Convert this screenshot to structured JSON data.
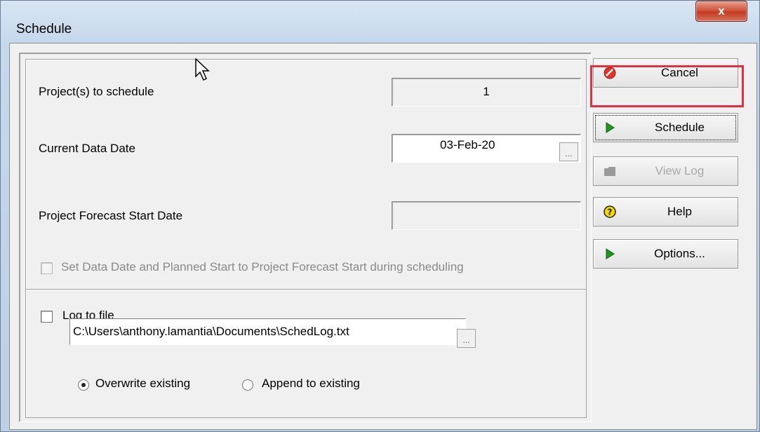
{
  "window": {
    "title": "Schedule",
    "close_glyph": "x"
  },
  "fields": {
    "projects_label": "Project(s) to schedule",
    "projects_value": "1",
    "data_date_label": "Current Data Date",
    "data_date_value": "03-Feb-20",
    "forecast_label": "Project Forecast Start Date",
    "forecast_value": "",
    "ellipsis": "..."
  },
  "options": {
    "set_data_date_label": "Set Data Date and Planned Start to Project Forecast Start during scheduling",
    "set_data_date_checked": false,
    "log_to_file_label": "Log to file",
    "log_to_file_checked": false,
    "log_path": "C:\\Users\\anthony.lamantia\\Documents\\SchedLog.txt",
    "overwrite_label": "Overwrite existing",
    "append_label": "Append to existing",
    "write_mode": "overwrite"
  },
  "buttons": {
    "cancel": {
      "label": "Cancel",
      "icon": "no-entry-icon",
      "color": "#e0332b"
    },
    "schedule": {
      "label": "Schedule",
      "icon": "play-triangle-icon",
      "color": "#1f9a1f"
    },
    "view_log": {
      "label": "View Log",
      "icon": "folder-icon"
    },
    "help": {
      "label": "Help",
      "icon": "help-icon",
      "color": "#f5d800"
    },
    "options": {
      "label": "Options...",
      "icon": "play-triangle-icon",
      "color": "#1f9a1f"
    }
  },
  "annotation": {
    "highlight_color": "#e53040"
  }
}
